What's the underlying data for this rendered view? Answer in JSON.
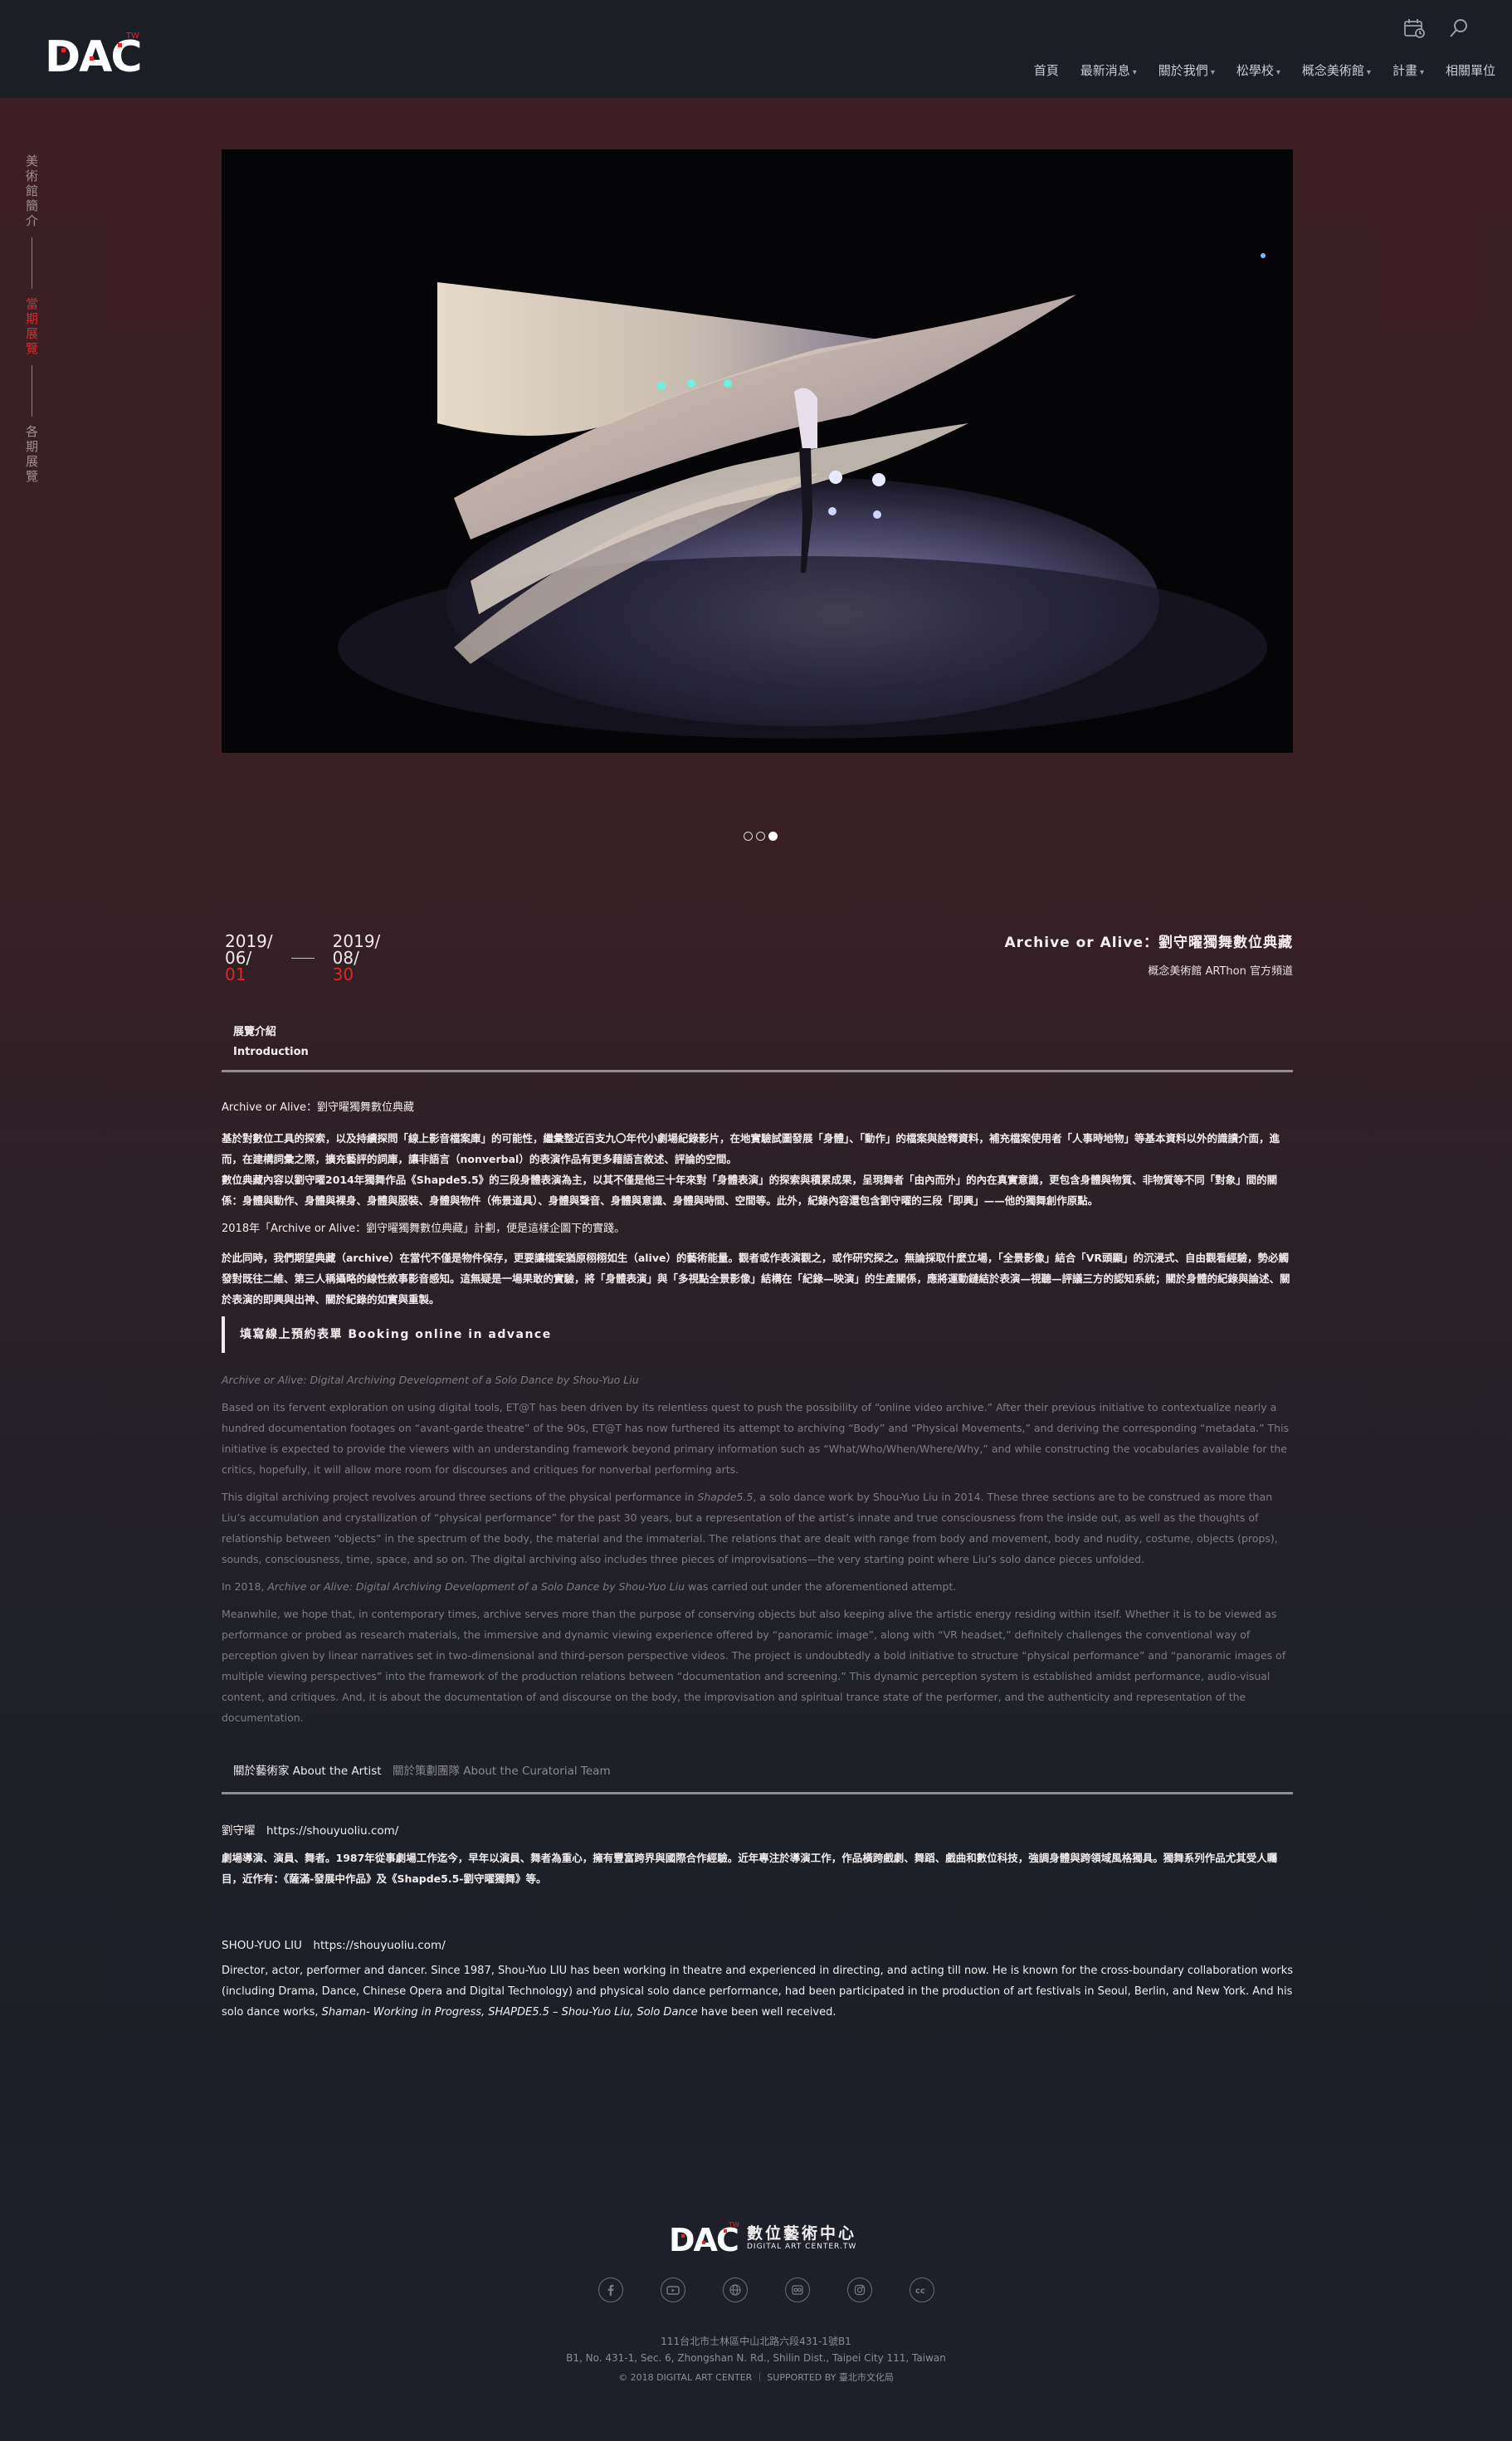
{
  "header": {
    "logo_text": "DAC",
    "logo_tm": "TW",
    "nav": [
      {
        "label": "首頁",
        "dropdown": false
      },
      {
        "label": "最新消息",
        "dropdown": true
      },
      {
        "label": "關於我們",
        "dropdown": true
      },
      {
        "label": "松學校",
        "dropdown": true
      },
      {
        "label": "概念美術館",
        "dropdown": true
      },
      {
        "label": "計畫",
        "dropdown": true
      },
      {
        "label": "相關單位",
        "dropdown": false
      }
    ],
    "tools": [
      "calendar-icon",
      "search-icon"
    ]
  },
  "side_menu": {
    "items": [
      {
        "label": "美術館簡介",
        "active": false
      },
      {
        "label": "當期展覽",
        "active": true
      },
      {
        "label": "各期展覽",
        "active": false
      }
    ]
  },
  "carousel": {
    "slides": 3,
    "active_index": 2
  },
  "exhibition": {
    "start": {
      "year": "2019/",
      "month": "06/",
      "day": "01"
    },
    "end": {
      "year": "2019/",
      "month": "08/",
      "day": "30"
    },
    "title": "Archive or Alive：劉守曜獨舞數位典藏",
    "venue": "概念美術館 ARThon 官方頻道"
  },
  "tabs_intro": {
    "zh": "展覽介紹",
    "en": "Introduction"
  },
  "intro_zh": {
    "heading": "Archive or Alive：劉守曜獨舞數位典藏",
    "p1": "基於對數位工具的探索，以及持續探問「線上影音檔案庫」的可能性，繼彙整近百支九〇年代小劇場紀錄影片，在地實驗試圖發展「身體」、「動作」的檔案與詮釋資料，補充檔案使用者「人事時地物」等基本資料以外的識讀介面，進而，在建構詞彙之際，擴充藝評的詞庫，讓非語言（nonverbal）的表演作品有更多藉語言敘述、評論的空間。",
    "p2": "數位典藏內容以劉守曜2014年獨舞作品《Shapde5.5》的三段身體表演為主，以其不僅是他三十年來對「身體表演」的探索與積累成果，呈現舞者「由內而外」的內在真實意識，更包含身體與物質、非物質等不同「對象」間的關係：身體與動作、身體與裸身、身體與服裝、身體與物件（佈景道具）、身體與聲音、身體與意識、身體與時間、空間等。此外，紀錄內容還包含劉守曜的三段「即興」——他的獨舞創作原點。",
    "p3": "2018年「Archive or Alive：劉守曜獨舞數位典藏」計劃，便是這樣企圖下的實踐。",
    "p4": "於此同時，我們期望典藏（archive）在當代不僅是物件保存，更要讓檔案猶原栩栩如生（alive）的藝術能量。觀者或作表演觀之，或作研究探之。無論採取什麼立場，「全景影像」結合「VR頭顯」的沉浸式、自由觀看經驗，勢必觸發對既往二維、第三人稱攝略的線性敘事影音感知。這無疑是一場果敢的實驗，將「身體表演」與「多視點全景影像」結構在「紀錄—映演」的生產關係，應將運動鏈結於表演—視聽—評議三方的認知系統；關於身體的紀錄與論述、關於表演的即興與出神、關於紀錄的如實與重製。"
  },
  "booking_label": "填寫線上預約表單 Booking online in advance",
  "intro_en": {
    "heading": "Archive or Alive: Digital Archiving Development of a Solo Dance by Shou-Yuo Liu",
    "p1": "Based on its fervent exploration on using digital tools, ET@T has been driven by its relentless quest to push the possibility of “online video archive.” After their previous initiative to contextualize nearly a hundred documentation footages on “avant-garde theatre” of the 90s, ET@T has now furthered its attempt to archiving “Body” and “Physical Movements,” and deriving the corresponding “metadata.” This initiative is expected to provide the viewers with an understanding framework beyond primary information such as “What/Who/When/Where/Why,” and while constructing the vocabularies available for the critics, hopefully, it will allow more room for discourses and critiques for nonverbal performing arts.",
    "p2_pre": "This digital archiving project revolves around three sections of the physical performance in ",
    "p2_work": "Shapde5.5",
    "p2_post": ", a solo dance work by Shou-Yuo Liu in 2014. These three sections are to be construed as more than Liu’s accumulation and crystallization of “physical performance” for the past 30 years, but a representation of the artist’s innate and true consciousness from the inside out, as well as the thoughts of relationship between “objects” in the spectrum of the body, the material and the immaterial. The relations that are dealt with range from body and movement, body and nudity, costume, objects (props), sounds, consciousness, time, space, and so on. The digital archiving also includes three pieces of improvisations—the very starting point where Liu’s solo dance pieces unfolded.",
    "p3_pre": "In 2018, ",
    "p3_work": "Archive or Alive: Digital Archiving Development of a Solo Dance by Shou-Yuo Liu",
    "p3_post": " was carried out under the aforementioned attempt.",
    "p4": "Meanwhile, we hope that, in contemporary times, archive serves more than the purpose of conserving objects but also keeping alive the artistic energy residing within itself. Whether it is to be viewed as performance or probed as research materials, the immersive and dynamic viewing experience offered by “panoramic image”, along with “VR headset,” definitely challenges the conventional way of perception given by linear narratives set in two-dimensional and third-person perspective videos. The project is undoubtedly a bold initiative to structure “physical performance” and “panoramic images of multiple viewing perspectives” into the framework of the production relations between “documentation and screening.” This dynamic perception system is established amidst performance, audio-visual content, and critiques. And, it is about the documentation of and discourse on the body, the improvisation and spiritual trance state of the performer, and the authenticity and representation of the documentation."
  },
  "tabs_artist": {
    "artist": "關於藝術家 About the Artist",
    "team": "關於策劃團隊 About the Curatorial Team"
  },
  "artist": {
    "zh_head": "劉守曜　https://shouyuoliu.com/",
    "zh_bio": "劇場導演、演員、舞者。1987年從事劇場工作迄今，早年以演員、舞者為重心，擁有豐富跨界與國際合作經驗。近年專注於導演工作，作品橫跨戲劇、舞蹈、戲曲和數位科技，強調身體與跨領域風格獨具。獨舞系列作品尤其受人矚目，近作有：《薩滿-發展中作品》及《Shapde5.5-劉守曜獨舞》等。",
    "en_head": "SHOU-YUO LIU　https://shouyuoliu.com/",
    "en_bio_pre": "Director, actor, performer and dancer. Since 1987, Shou-Yuo LIU has been working in theatre and experienced in directing, and acting till now. He is known for the cross-boundary collaboration works (including Drama, Dance, Chinese Opera and Digital Technology) and physical solo dance performance, had been participated in the production of art festivals in Seoul, Berlin, and New York. And his solo dance works, ",
    "en_bio_works": "Shaman- Working in Progress, SHAPDE5.5 – Shou-Yuo Liu, Solo Dance",
    "en_bio_post": " have been well received."
  },
  "footer": {
    "brand_zh": "數位藝術中心",
    "brand_en": "DIGITAL ART CENTER.TW",
    "socials": [
      "facebook-icon",
      "youtube-icon",
      "website-icon",
      "flickr-icon",
      "instagram-icon",
      "creative-commons-icon"
    ],
    "address_zh": "111台北市士林區中山北路六段431-1號B1",
    "address_en": "B1, No. 431-1, Sec. 6, Zhongshan N. Rd., Shilin Dist., Taipei City 111, Taiwan",
    "copyright": "© 2018 DIGITAL ART CENTER ｜ SUPPORTED BY 臺北市文化局"
  },
  "colors": {
    "accent": "#e02727",
    "header_bg": "#1b1e25",
    "page_bg": "#3b1f24",
    "footer_bg": "#1d2029"
  }
}
